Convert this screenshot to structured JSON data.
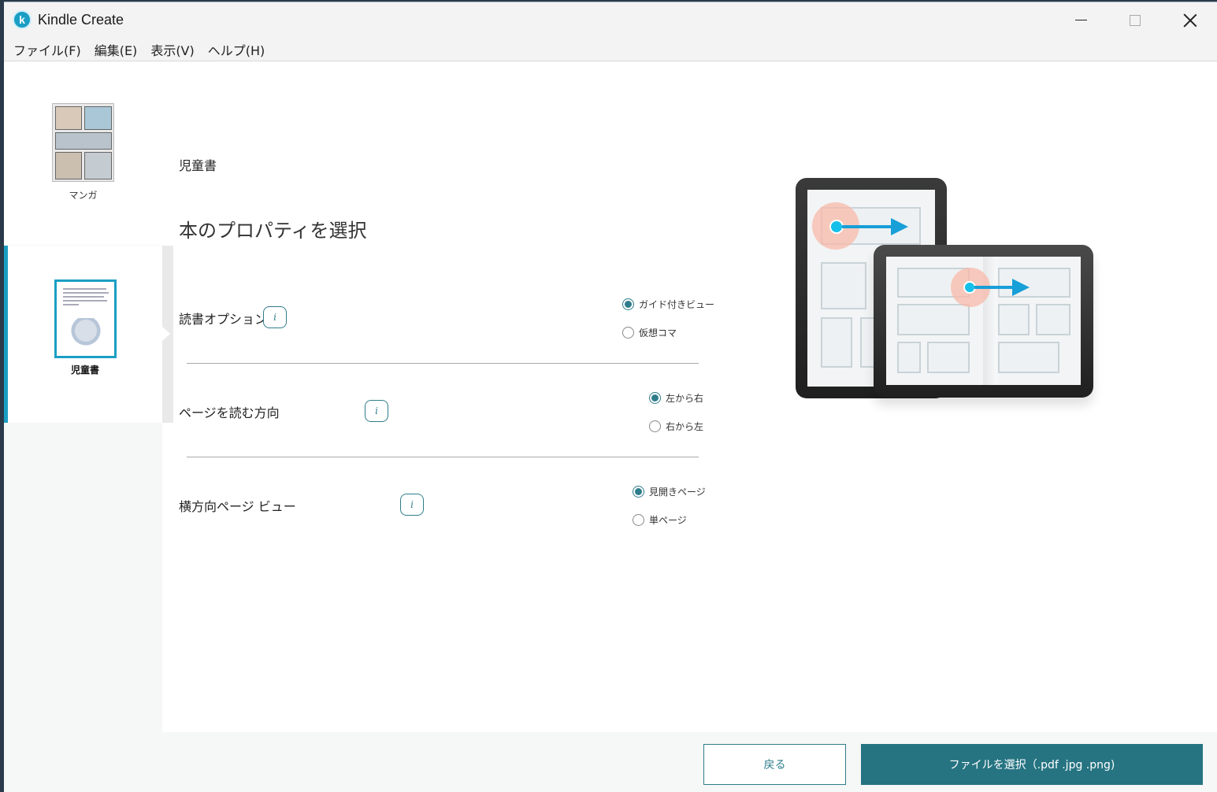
{
  "window": {
    "title": "Kindle Create",
    "app_icon_letter": "k"
  },
  "menu": {
    "items": [
      {
        "label": "ファイル(F)"
      },
      {
        "label": "編集(E)"
      },
      {
        "label": "表示(V)"
      },
      {
        "label": "ヘルプ(H)"
      }
    ]
  },
  "sidebar": {
    "items": [
      {
        "label": "マンガ",
        "selected": false
      },
      {
        "label": "児童書",
        "selected": true
      }
    ]
  },
  "main": {
    "category": "児童書",
    "title": "本のプロパティを選択",
    "options": [
      {
        "label": "読書オプション",
        "info": "i",
        "choices": [
          {
            "label": "ガイド付きビュー",
            "checked": true
          },
          {
            "label": "仮想コマ",
            "checked": false
          }
        ]
      },
      {
        "label": "ページを読む方向",
        "info": "i",
        "choices": [
          {
            "label": "左から右",
            "checked": true
          },
          {
            "label": "右から左",
            "checked": false
          }
        ]
      },
      {
        "label": "横方向ページ ビュー",
        "info": "i",
        "choices": [
          {
            "label": "見開きページ",
            "checked": true
          },
          {
            "label": "単ページ",
            "checked": false
          }
        ]
      }
    ]
  },
  "footer": {
    "back_label": "戻る",
    "select_label": "ファイルを選択（.pdf .jpg .png)"
  },
  "colors": {
    "accent": "#267482",
    "sidebar_selected": "#1a9ec4"
  }
}
